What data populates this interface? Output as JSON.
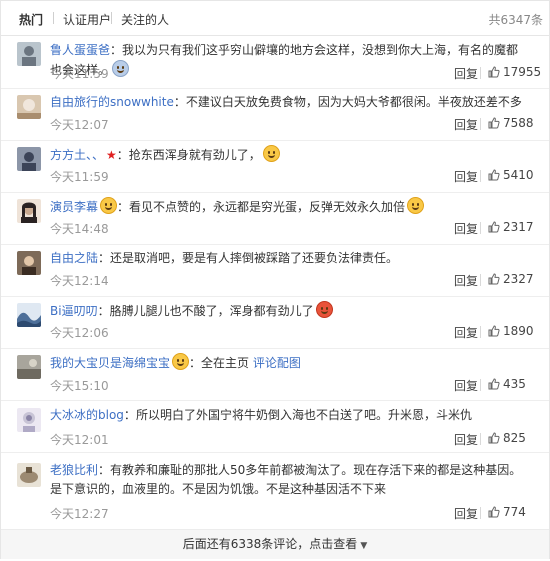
{
  "tabs": [
    {
      "label": "热门",
      "active": true
    },
    {
      "label": "认证用户",
      "active": false
    },
    {
      "label": "关注的人",
      "active": false
    }
  ],
  "total": "共6347条",
  "reply_label": "回复",
  "comments": [
    {
      "user": "鲁人蛋蛋爸",
      "sep": "：",
      "content": "我以为只有我们这乎穷山僻壤的地方会这样，没想到你大上海，有名的魔都也会这样。",
      "time": "今天11:59",
      "likes": "17955",
      "avatar": "#b9c4cc"
    },
    {
      "user": "自由旅行的snowwhite",
      "sep": "：",
      "content": "不建议白天放免费食物，因为大妈大爷都很闲。半夜放还差不多",
      "time": "今天12:07",
      "likes": "7588",
      "avatar": "#d9c7b0"
    },
    {
      "user": "方方土、、",
      "sep": "：",
      "content": "抢东西浑身就有劲儿了，",
      "time": "今天11:59",
      "likes": "5410",
      "avatar": "#8c96a8"
    },
    {
      "user": "演员李幕",
      "sep": "：",
      "content": "看见不点赞的，永远都是穷光蛋，反弹无效永久加倍",
      "time": "今天14:48",
      "likes": "2317",
      "avatar": "#c9a990"
    },
    {
      "user": "自由之陆",
      "sep": "：",
      "content": "还是取消吧，要是有人摔倒被踩踏了还要负法律责任。",
      "time": "今天12:14",
      "likes": "2327",
      "avatar": "#7d6a58"
    },
    {
      "user": "Bi逼叨叨",
      "sep": "：",
      "content": "胳膊儿腿儿也不酸了，浑身都有劲儿了",
      "time": "今天12:06",
      "likes": "1890",
      "avatar": "#4d6f99"
    },
    {
      "user": "我的大宝贝是海绵宝宝",
      "sep": "：",
      "content": "全在主页",
      "extra_link": "评论配图",
      "time": "今天15:10",
      "likes": "435",
      "avatar": "#a8a59c"
    },
    {
      "user": "大冰冰的blog",
      "sep": "：",
      "content": "所以明白了外国宁将牛奶倒入海也不白送了吧。升米恩，斗米仇",
      "time": "今天12:01",
      "likes": "825",
      "avatar": "#c8c4d6"
    },
    {
      "user": "老狼比利",
      "sep": "：",
      "content": "有教养和廉耻的那批人50多年前都被淘汰了。现在存活下来的都是这种基因。是下意识的，血液里的。不是因为饥饿。不是这种基因活不下来",
      "time": "今天12:27",
      "likes": "774",
      "avatar": "#9c8a72"
    }
  ],
  "footer_text": "后面还有6338条评论，点击查看",
  "colors": {
    "username": "#3d6fc4",
    "time": "#999999",
    "border": "#e6e6e6"
  },
  "icons": {
    "like": "thumbs-up-icon",
    "more": "chevron-down-icon"
  }
}
